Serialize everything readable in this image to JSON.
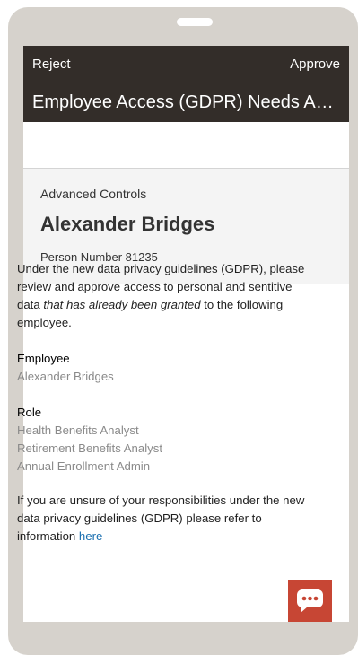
{
  "header": {
    "reject_label": "Reject",
    "approve_label": "Approve",
    "title": "Employee Access (GDPR) Needs Approval"
  },
  "summary": {
    "subtitle": "Advanced Controls",
    "name": "Alexander Bridges",
    "person_number": "Person Number 81235"
  },
  "details": {
    "intro_before": "Under the new data privacy guidelines (GDPR), please review and approve access to personal and sentitive data ",
    "intro_emphasis": "that has already been granted",
    "intro_after": " to the following employee.",
    "employee_label": "Employee",
    "employee_value": "Alexander Bridges",
    "role_label": "Role",
    "roles": [
      "Health Benefits Analyst",
      "Retirement Benefits Analyst",
      "Annual Enrollment Admin"
    ],
    "footer_before": "If you are unsure of your responsibilities under the new data privacy guidelines (GDPR) please refer to information ",
    "footer_link": "here"
  },
  "colors": {
    "header_bg": "#332d29",
    "accent": "#c74634",
    "link": "#1a6fb0",
    "device_frame": "#d6d2cc"
  },
  "icons": {
    "chat": "chat-bubble-icon"
  }
}
